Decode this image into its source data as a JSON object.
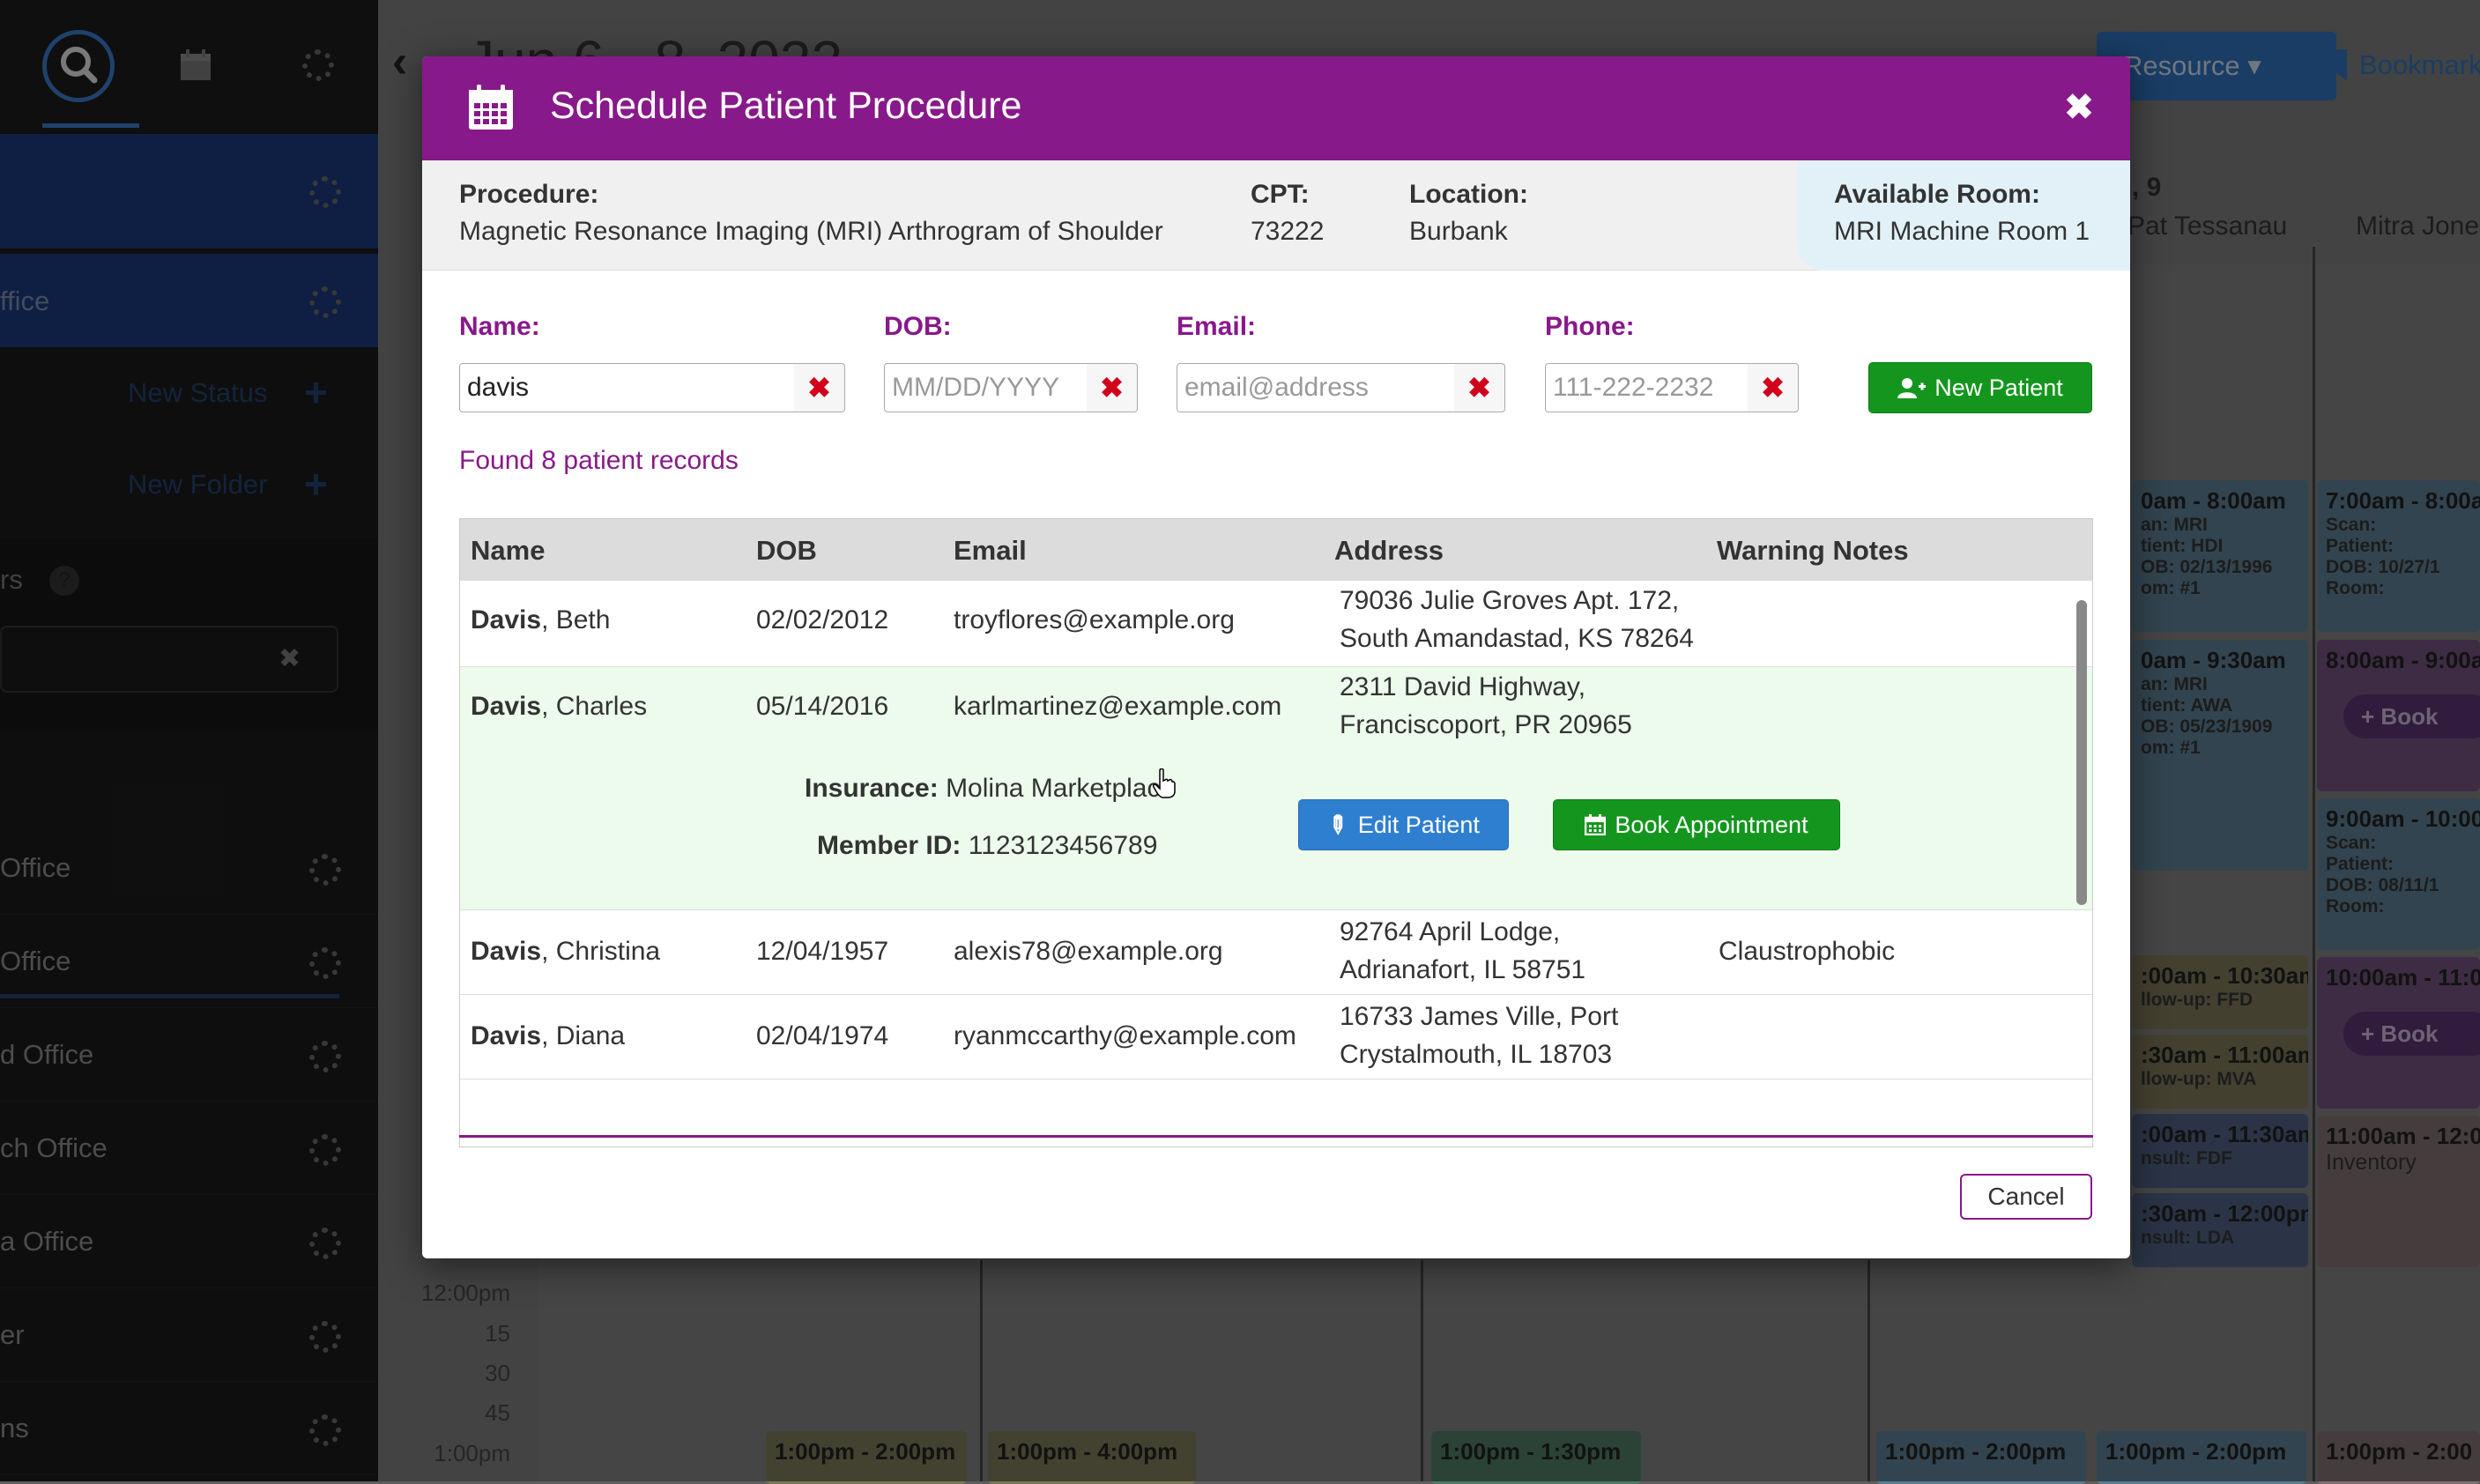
{
  "background": {
    "sidebar": {
      "items": [
        {
          "label": "New Status"
        },
        {
          "label": "New Folder"
        },
        {
          "label": "rs"
        },
        {
          "label": "Office"
        },
        {
          "label": "Office"
        },
        {
          "label": "d Office"
        },
        {
          "label": "ch Office"
        },
        {
          "label": "a Office"
        },
        {
          "label": "er"
        },
        {
          "label": "ns"
        },
        {
          "label": "ffice"
        }
      ]
    },
    "calendar": {
      "title": "Jun 6 - 8, 2022",
      "resource_button": "Resource",
      "bookmark_label": "Bookmark",
      "columns": [
        {
          "day": ", 9",
          "name": "Pat Tessanau"
        },
        {
          "day": "",
          "name": "Mitra Jone"
        }
      ],
      "times": [
        "12:00pm",
        "15",
        "30",
        "45",
        "1:00pm"
      ],
      "blocks": [
        {
          "time": "0am - 8:00am",
          "lines": [
            "an:  MRI",
            "tient:  HDI",
            "OB:  02/13/1996",
            "om:  #1"
          ]
        },
        {
          "time": "0am - 9:30am",
          "lines": [
            "an:  MRI",
            "tient:  AWA",
            "OB:  05/23/1909",
            "om:  #1"
          ]
        },
        {
          "time": ":00am - 10:30am",
          "lines": [
            "llow-up: FFD"
          ]
        },
        {
          "time": ":30am - 11:00am",
          "lines": [
            "llow-up: MVA"
          ]
        },
        {
          "time": ":00am - 11:30am",
          "lines": [
            "nsult: FDF"
          ]
        },
        {
          "time": ":30am - 12:00pm",
          "lines": [
            "nsult: LDA"
          ]
        },
        {
          "time": "7:00am - 8:00a",
          "lines": [
            "Scan:",
            "Patient:",
            "DOB:  10/27/1",
            "Room:"
          ]
        },
        {
          "time": "8:00am - 9:00a",
          "lines": [
            "Book"
          ]
        },
        {
          "time": "9:00am - 10:00",
          "lines": [
            "Scan:",
            "Patient:",
            "DOB:  08/11/1",
            "Room:"
          ]
        },
        {
          "time": "10:00am - 11:0",
          "lines": [
            "Book"
          ]
        },
        {
          "time": "11:00am - 12:0",
          "lines": [
            "Inventory"
          ]
        }
      ],
      "bottom_blocks": [
        "1:00pm - 2:00pm",
        "1:00pm - 4:00pm",
        "1:00pm - 1:30pm",
        "1:00pm - 2:00pm",
        "1:00pm - 2:00pm",
        "1:00pm - 2:00"
      ]
    }
  },
  "modal": {
    "title": "Schedule Patient Procedure",
    "close_glyph": "✖",
    "procedure": {
      "procedure_label": "Procedure:",
      "procedure_value": "Magnetic Resonance Imaging (MRI) Arthrogram of Shoulder",
      "cpt_label": "CPT:",
      "cpt_value": "73222",
      "location_label": "Location:",
      "location_value": "Burbank",
      "room_label": "Available Room:",
      "room_value": "MRI Machine Room 1"
    },
    "search": {
      "name_label": "Name:",
      "name_value": "davis",
      "dob_label": "DOB:",
      "dob_placeholder": "MM/DD/YYYY",
      "email_label": "Email:",
      "email_placeholder": "email@address",
      "phone_label": "Phone:",
      "phone_placeholder": "111-222-2232",
      "clear_glyph": "✖",
      "new_patient_label": "New Patient"
    },
    "found_text": "Found 8 patient records",
    "table": {
      "headers": [
        "Name",
        "DOB",
        "Email",
        "Address",
        "Warning Notes"
      ],
      "rows": [
        {
          "last": "Davis",
          "first": ", Beth",
          "dob": "02/02/2012",
          "email": "troyflores@example.org",
          "address1": "79036 Julie Groves Apt. 172,",
          "address2": "South Amandastad, KS 78264",
          "warning": ""
        },
        {
          "last": "Davis",
          "first": ", Charles",
          "dob": "05/14/2016",
          "email": "karlmartinez@example.com",
          "address1": "2311 David Highway,",
          "address2": "Franciscoport, PR 20965",
          "warning": ""
        },
        {
          "last": "Davis",
          "first": ", Christina",
          "dob": "12/04/1957",
          "email": "alexis78@example.org",
          "address1": "92764 April Lodge,",
          "address2": "Adrianafort, IL 58751",
          "warning": "Claustrophobic"
        },
        {
          "last": "Davis",
          "first": ", Diana",
          "dob": "02/04/1974",
          "email": "ryanmccarthy@example.com",
          "address1": "16733 James Ville, Port",
          "address2": "Crystalmouth, IL 18703",
          "warning": ""
        }
      ],
      "expanded": {
        "insurance_label": "Insurance:",
        "insurance_value": "Molina Marketplace",
        "member_label": "Member ID:",
        "member_value": "1123123456789",
        "edit_label": "Edit Patient",
        "book_label": "Book Appointment"
      }
    },
    "cancel_label": "Cancel"
  },
  "colors": {
    "modal_header": "#88198a",
    "accent_purple": "#88198a",
    "green_button": "#14961e",
    "blue_button": "#2f7fd1",
    "expanded_row": "#ecfbec",
    "available_room_bg": "#e2f1f8",
    "clear_x": "#d0021b"
  },
  "icons": [
    "search-icon",
    "calendar-icon",
    "gear-icon",
    "plus-icon",
    "help-icon",
    "close-icon",
    "chevron-left-icon",
    "bookmark-icon",
    "user-plus-icon",
    "pencil-icon",
    "clear-icon"
  ]
}
